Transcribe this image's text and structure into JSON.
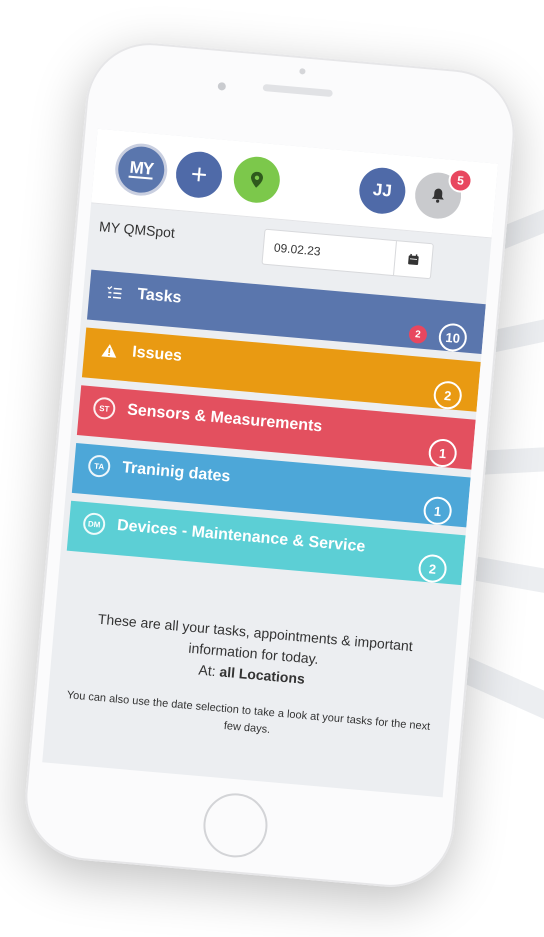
{
  "header": {
    "logo_text": "MY",
    "add_label": "+",
    "user_initials": "JJ",
    "notification_count": "5"
  },
  "page": {
    "title": "MY QMSpot",
    "date_value": "09.02.23"
  },
  "categories": [
    {
      "label": "Tasks",
      "icon": "task-list-icon",
      "icon_text": "",
      "badge": "2",
      "count": "10",
      "color": "#5a76ad"
    },
    {
      "label": "Issues",
      "icon": "warning-icon",
      "icon_text": "",
      "count": "2",
      "color": "#e99a12"
    },
    {
      "label": "Sensors & Measurements",
      "icon": "st-icon",
      "icon_text": "ST",
      "count": "1",
      "color": "#e3505f"
    },
    {
      "label": "Traninig dates",
      "icon": "ta-icon",
      "icon_text": "TA",
      "count": "1",
      "color": "#4da7d8"
    },
    {
      "label": "Devices - Maintenance & Service",
      "icon": "dm-icon",
      "icon_text": "DM",
      "count": "2",
      "color": "#5ccfd5"
    }
  ],
  "info": {
    "main": "These are all your tasks, appointments & important information for today.",
    "at_label": "At:",
    "location": "all Locations",
    "sub": "You can also use the date selection to take a look at your tasks for the next few days."
  }
}
